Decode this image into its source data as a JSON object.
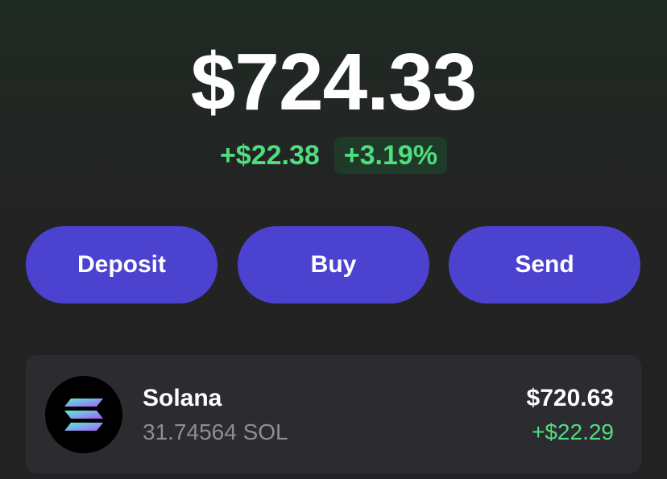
{
  "balance": {
    "total": "$724.33",
    "change_amount": "+$22.38",
    "change_percent": "+3.19%"
  },
  "actions": {
    "deposit_label": "Deposit",
    "buy_label": "Buy",
    "send_label": "Send"
  },
  "tokens": [
    {
      "name": "Solana",
      "amount": "31.74564 SOL",
      "value": "$720.63",
      "change": "+$22.29",
      "icon": "solana-logo-icon"
    }
  ],
  "colors": {
    "accent": "#4b43cf",
    "positive": "#4ede7e",
    "positive_badge_bg": "#1f3a29",
    "card_bg": "#2c2c30",
    "secondary_text": "#8e8e93"
  }
}
